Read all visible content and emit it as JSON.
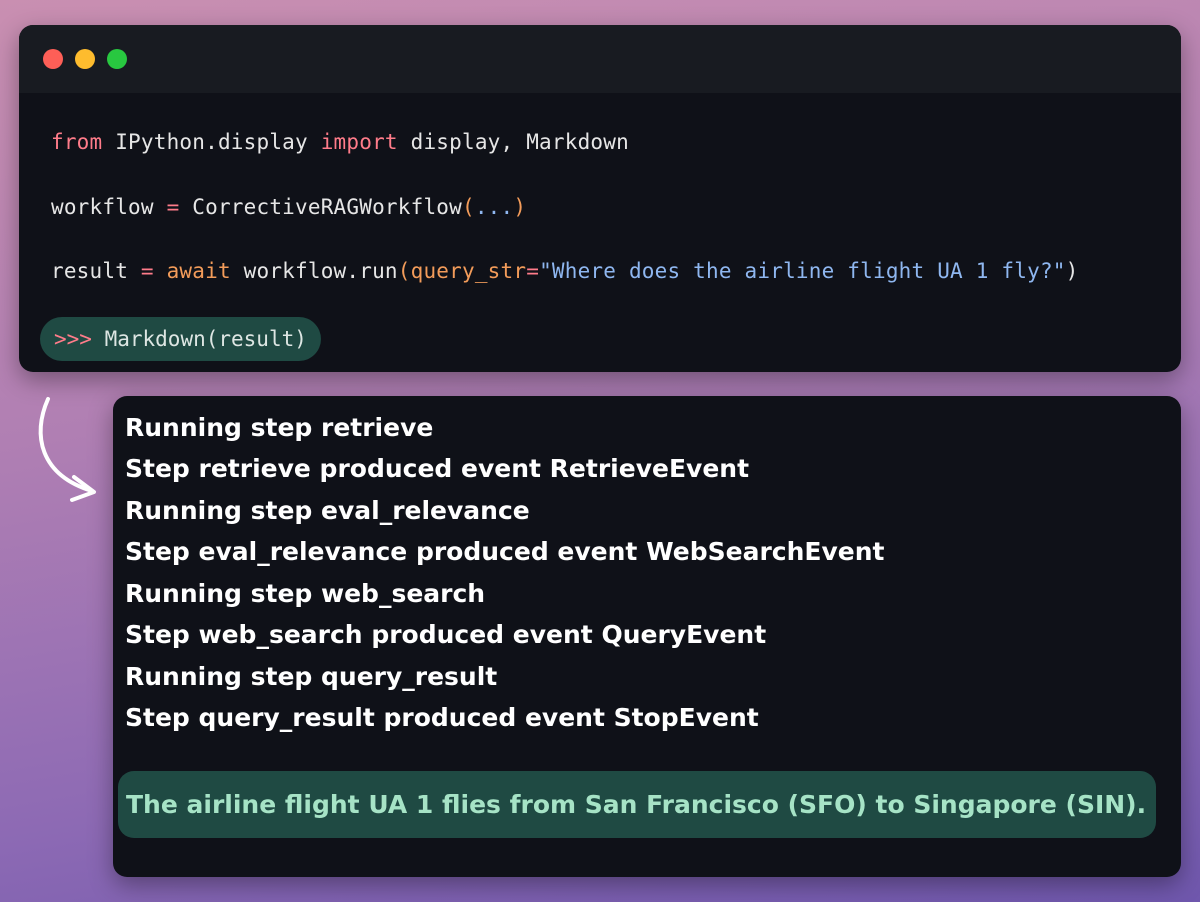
{
  "code": {
    "line1": {
      "kw1": "from",
      "mod": " IPython.display ",
      "kw2": "import",
      "rest": " display, Markdown"
    },
    "line2": {
      "lhs": "workflow ",
      "op": "=",
      "rhs": " CorrectiveRAGWorkflow",
      "paren_open": "(",
      "args": "...",
      "paren_close": ")"
    },
    "line3": {
      "lhs": "result ",
      "op": "=",
      "sp": " ",
      "kw": "await",
      "call": " workflow.run",
      "paren_open": "(",
      "param": "query_str",
      "eq": "=",
      "str": "\"Where does the airline flight UA 1 fly?\"",
      "paren_close": ")"
    },
    "prompt": {
      "chevrons": ">>>",
      "text": " Markdown(result)"
    }
  },
  "output": {
    "log": [
      "Running step retrieve",
      "Step retrieve produced event RetrieveEvent",
      "Running step eval_relevance",
      "Step eval_relevance produced event WebSearchEvent",
      "Running step web_search",
      "Step web_search produced event QueryEvent",
      "Running step query_result",
      "Step query_result produced event StopEvent"
    ],
    "result": "The airline flight UA 1 flies from San Francisco (SFO) to Singapore (SIN)."
  },
  "colors": {
    "keyword": "#ff7c8a",
    "param": "#f39c5a",
    "string": "#8fb7f0",
    "highlight_bg": "#1f4a43",
    "result_text": "#a6e3c6"
  },
  "icons": [
    "close-dot",
    "minimize-dot",
    "maximize-dot",
    "curved-arrow-icon"
  ]
}
